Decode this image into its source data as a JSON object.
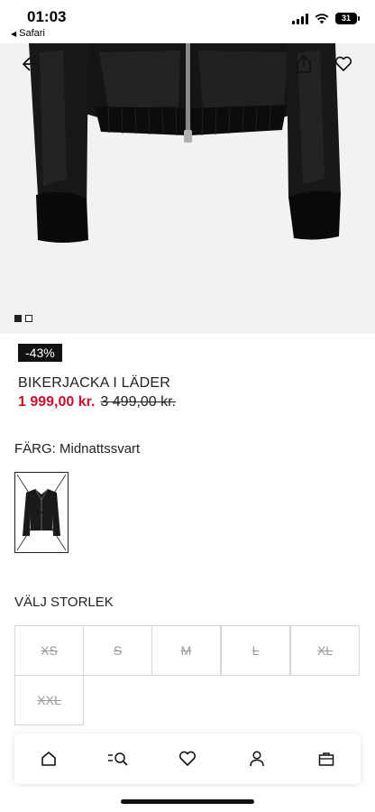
{
  "status_bar": {
    "time": "01:03",
    "back_app": "Safari",
    "battery": "31"
  },
  "product": {
    "discount": "-43%",
    "title": "BIKERJACKA I LÄDER",
    "price_sale": "1 999,00 kr.",
    "price_original": "3 499,00 kr.",
    "image_count": 2,
    "active_image": 1
  },
  "color": {
    "label": "FÄRG: Midnattssvart"
  },
  "sizes": {
    "label": "VÄLJ STORLEK",
    "options": [
      {
        "label": "XS",
        "available": false
      },
      {
        "label": "S",
        "available": false
      },
      {
        "label": "M",
        "available": false
      },
      {
        "label": "L",
        "available": false
      },
      {
        "label": "XL",
        "available": false
      },
      {
        "label": "XXL",
        "available": false
      }
    ]
  },
  "icons": {
    "back": "arrow-left-icon",
    "share": "share-icon",
    "favorite": "heart-icon",
    "nav": [
      "home-icon",
      "search-icon",
      "heart-icon",
      "user-icon",
      "bag-icon"
    ]
  }
}
